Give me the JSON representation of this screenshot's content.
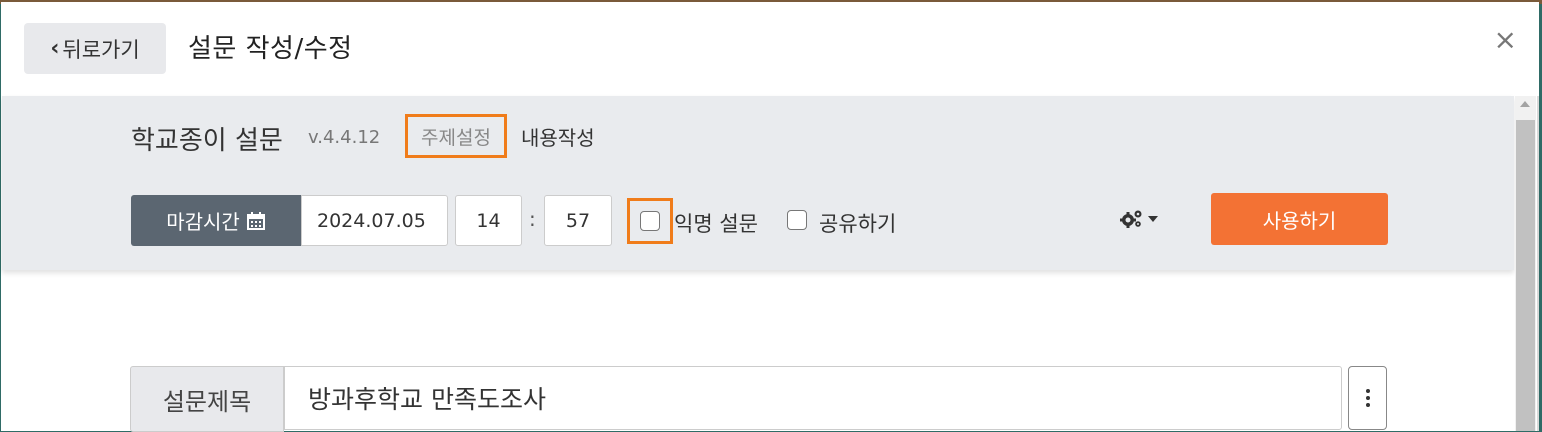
{
  "header": {
    "back_label": "뒤로가기",
    "title": "설문 작성/수정",
    "close_label": "×"
  },
  "app": {
    "name": "학교종이 설문",
    "version": "v.4.4.12",
    "tabs": [
      {
        "label": "주제설정",
        "highlighted": true
      },
      {
        "label": "내용작성"
      }
    ]
  },
  "deadline": {
    "button_label": "마감시간",
    "date": "2024.07.05",
    "hour": "14",
    "separator": ":",
    "minute": "57"
  },
  "options": {
    "anonymous_label": "익명 설문",
    "anonymous_checked": false,
    "share_label": "공유하기",
    "share_checked": false
  },
  "actions": {
    "use_label": "사용하기",
    "settings_icon": "gears-icon"
  },
  "survey": {
    "title_label": "설문제목",
    "title_value": "방과후학교 만족도조사"
  },
  "colors": {
    "highlight": "#f07c1a",
    "primary": "#f37234",
    "deadline_bg": "#5b6671"
  }
}
